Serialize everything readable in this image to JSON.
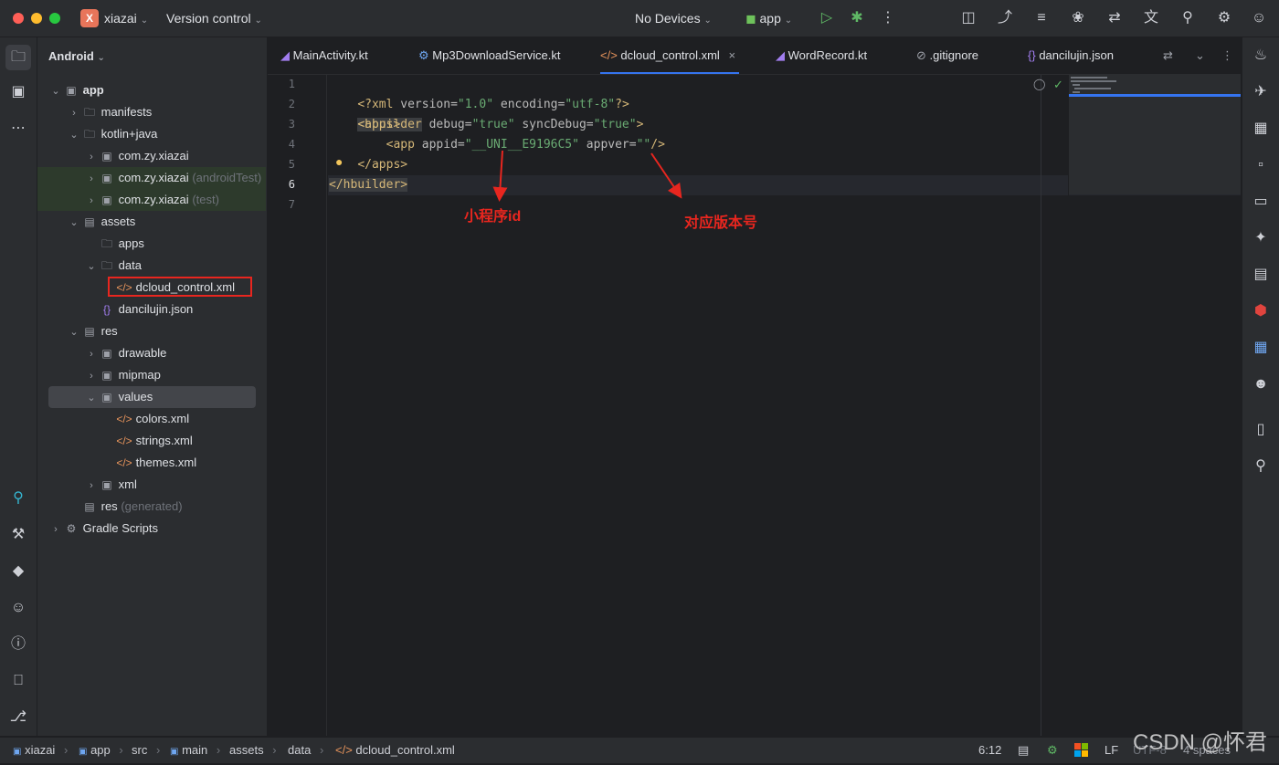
{
  "titlebar": {
    "project_badge": "X",
    "project_name": "xiazai",
    "version_control": "Version control",
    "devices": "No Devices",
    "run_config": "app"
  },
  "project_panel": {
    "view_mode": "Android",
    "tree": [
      {
        "label": "app",
        "suffix": ""
      },
      {
        "label": "manifests",
        "suffix": ""
      },
      {
        "label": "kotlin+java",
        "suffix": ""
      },
      {
        "label": "com.zy.xiazai",
        "suffix": ""
      },
      {
        "label": "com.zy.xiazai",
        "suffix": "(androidTest)"
      },
      {
        "label": "com.zy.xiazai",
        "suffix": "(test)"
      },
      {
        "label": "assets",
        "suffix": ""
      },
      {
        "label": "apps",
        "suffix": ""
      },
      {
        "label": "data",
        "suffix": ""
      },
      {
        "label": "dcloud_control.xml",
        "suffix": ""
      },
      {
        "label": "dancilujin.json",
        "suffix": ""
      },
      {
        "label": "res",
        "suffix": ""
      },
      {
        "label": "drawable",
        "suffix": ""
      },
      {
        "label": "mipmap",
        "suffix": ""
      },
      {
        "label": "values",
        "suffix": ""
      },
      {
        "label": "colors.xml",
        "suffix": ""
      },
      {
        "label": "strings.xml",
        "suffix": ""
      },
      {
        "label": "themes.xml",
        "suffix": ""
      },
      {
        "label": "xml",
        "suffix": ""
      },
      {
        "label": "res",
        "suffix": "(generated)"
      },
      {
        "label": "Gradle Scripts",
        "suffix": ""
      }
    ]
  },
  "tabs": [
    {
      "label": "MainActivity.kt"
    },
    {
      "label": "Mp3DownloadService.kt"
    },
    {
      "label": "dcloud_control.xml",
      "active": true
    },
    {
      "label": "WordRecord.kt"
    },
    {
      "label": ".gitignore"
    },
    {
      "label": "dancilujin.json"
    }
  ],
  "editor": {
    "line_numbers": [
      "1",
      "2",
      "3",
      "4",
      "5",
      "6",
      "7"
    ],
    "lines": [
      {
        "indent": "",
        "t1": "<?xml",
        "t2": " version=",
        "t3": "\"1.0\"",
        "t4": " encoding=",
        "t5": "\"utf-8\"",
        "t6": "?>"
      },
      {
        "tag_open": "<hbuilder",
        "a1": " debug=",
        "v1": "\"true\"",
        "a2": " syncDebug=",
        "v2": "\"true\"",
        "close": ">"
      },
      {
        "tag": "<apps>"
      },
      {
        "tag_open": "<app",
        "a1": " appid=",
        "v1": "\"__UNI__E9196C5\"",
        "a2": " appver=",
        "v2": "\"\"",
        "close": "/>"
      },
      {
        "tag": "</apps>"
      },
      {
        "tag": "</hbuilder>"
      },
      {
        "tag": ""
      }
    ]
  },
  "annotations": {
    "appid_label": "小程序id",
    "appver_label": "对应版本号"
  },
  "statusbar": {
    "breadcrumb": [
      "xiazai",
      "app",
      "src",
      "main",
      "assets",
      "data",
      "dcloud_control.xml"
    ],
    "position": "6:12",
    "line_sep": "LF",
    "encoding": "UTF-8",
    "indent": "4 spaces"
  },
  "watermark": "CSDN @怀君",
  "colors": {
    "accent": "#3574f0",
    "xml_tag": "#d5b778",
    "xml_attr": "#bababa",
    "xml_value": "#6aab73",
    "annotation_red": "#e8261f",
    "project_badge": "#e8755a"
  }
}
